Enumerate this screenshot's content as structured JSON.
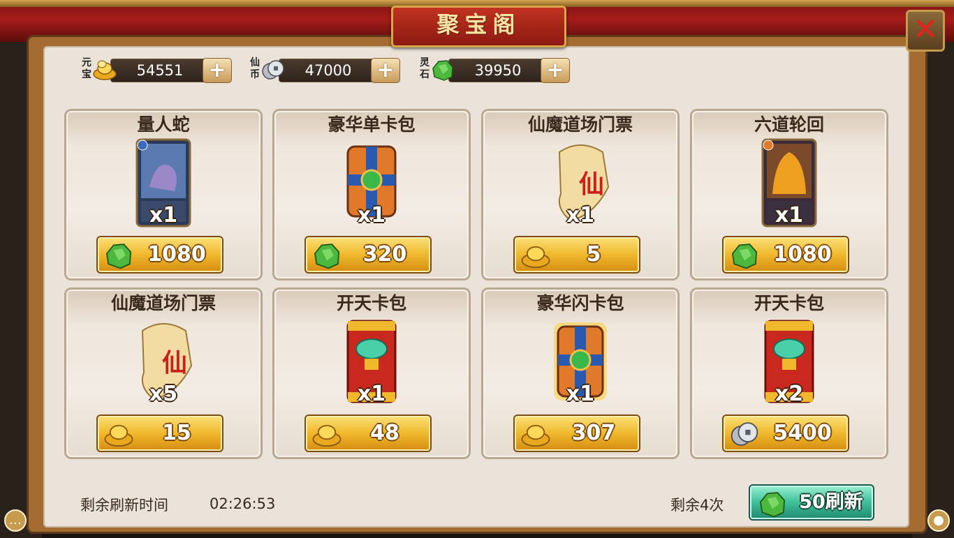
{
  "window": {
    "title": "聚宝阁"
  },
  "currencies": [
    {
      "label": "元宝",
      "value": "54551",
      "icon": "gold-ingot-icon"
    },
    {
      "label": "仙币",
      "value": "47000",
      "icon": "silver-coin-icon"
    },
    {
      "label": "灵石",
      "value": "39950",
      "icon": "jade-stone-icon"
    }
  ],
  "items": [
    {
      "name": "量人蛇",
      "qty": "x1",
      "price": "1080",
      "price_icon": "jade-stone-icon",
      "art": "card"
    },
    {
      "name": "豪华单卡包",
      "qty": "x1",
      "price": "320",
      "price_icon": "jade-stone-icon",
      "art": "card-pack"
    },
    {
      "name": "仙魔道场门票",
      "qty": "x1",
      "price": "5",
      "price_icon": "gold-ingot-icon",
      "art": "scroll"
    },
    {
      "name": "六道轮回",
      "qty": "x1",
      "price": "1080",
      "price_icon": "jade-stone-icon",
      "art": "card"
    },
    {
      "name": "仙魔道场门票",
      "qty": "x5",
      "price": "15",
      "price_icon": "gold-ingot-icon",
      "art": "scroll"
    },
    {
      "name": "开天卡包",
      "qty": "x1",
      "price": "48",
      "price_icon": "gold-ingot-icon",
      "art": "red-pack"
    },
    {
      "name": "豪华闪卡包",
      "qty": "x1",
      "price": "307",
      "price_icon": "gold-ingot-icon",
      "art": "card-pack"
    },
    {
      "name": "开天卡包",
      "qty": "x2",
      "price": "5400",
      "price_icon": "silver-coin-icon",
      "art": "red-pack"
    }
  ],
  "footer": {
    "refresh_time_label": "剩余刷新时间",
    "refresh_time": "02:26:53",
    "remaining": "剩余4次",
    "refresh_button": "50刷新"
  },
  "colors": {
    "gold": "#f0b82c",
    "jade": "#3fa63a",
    "curtain": "#a51d1a",
    "teal": "#3fbf9a"
  }
}
